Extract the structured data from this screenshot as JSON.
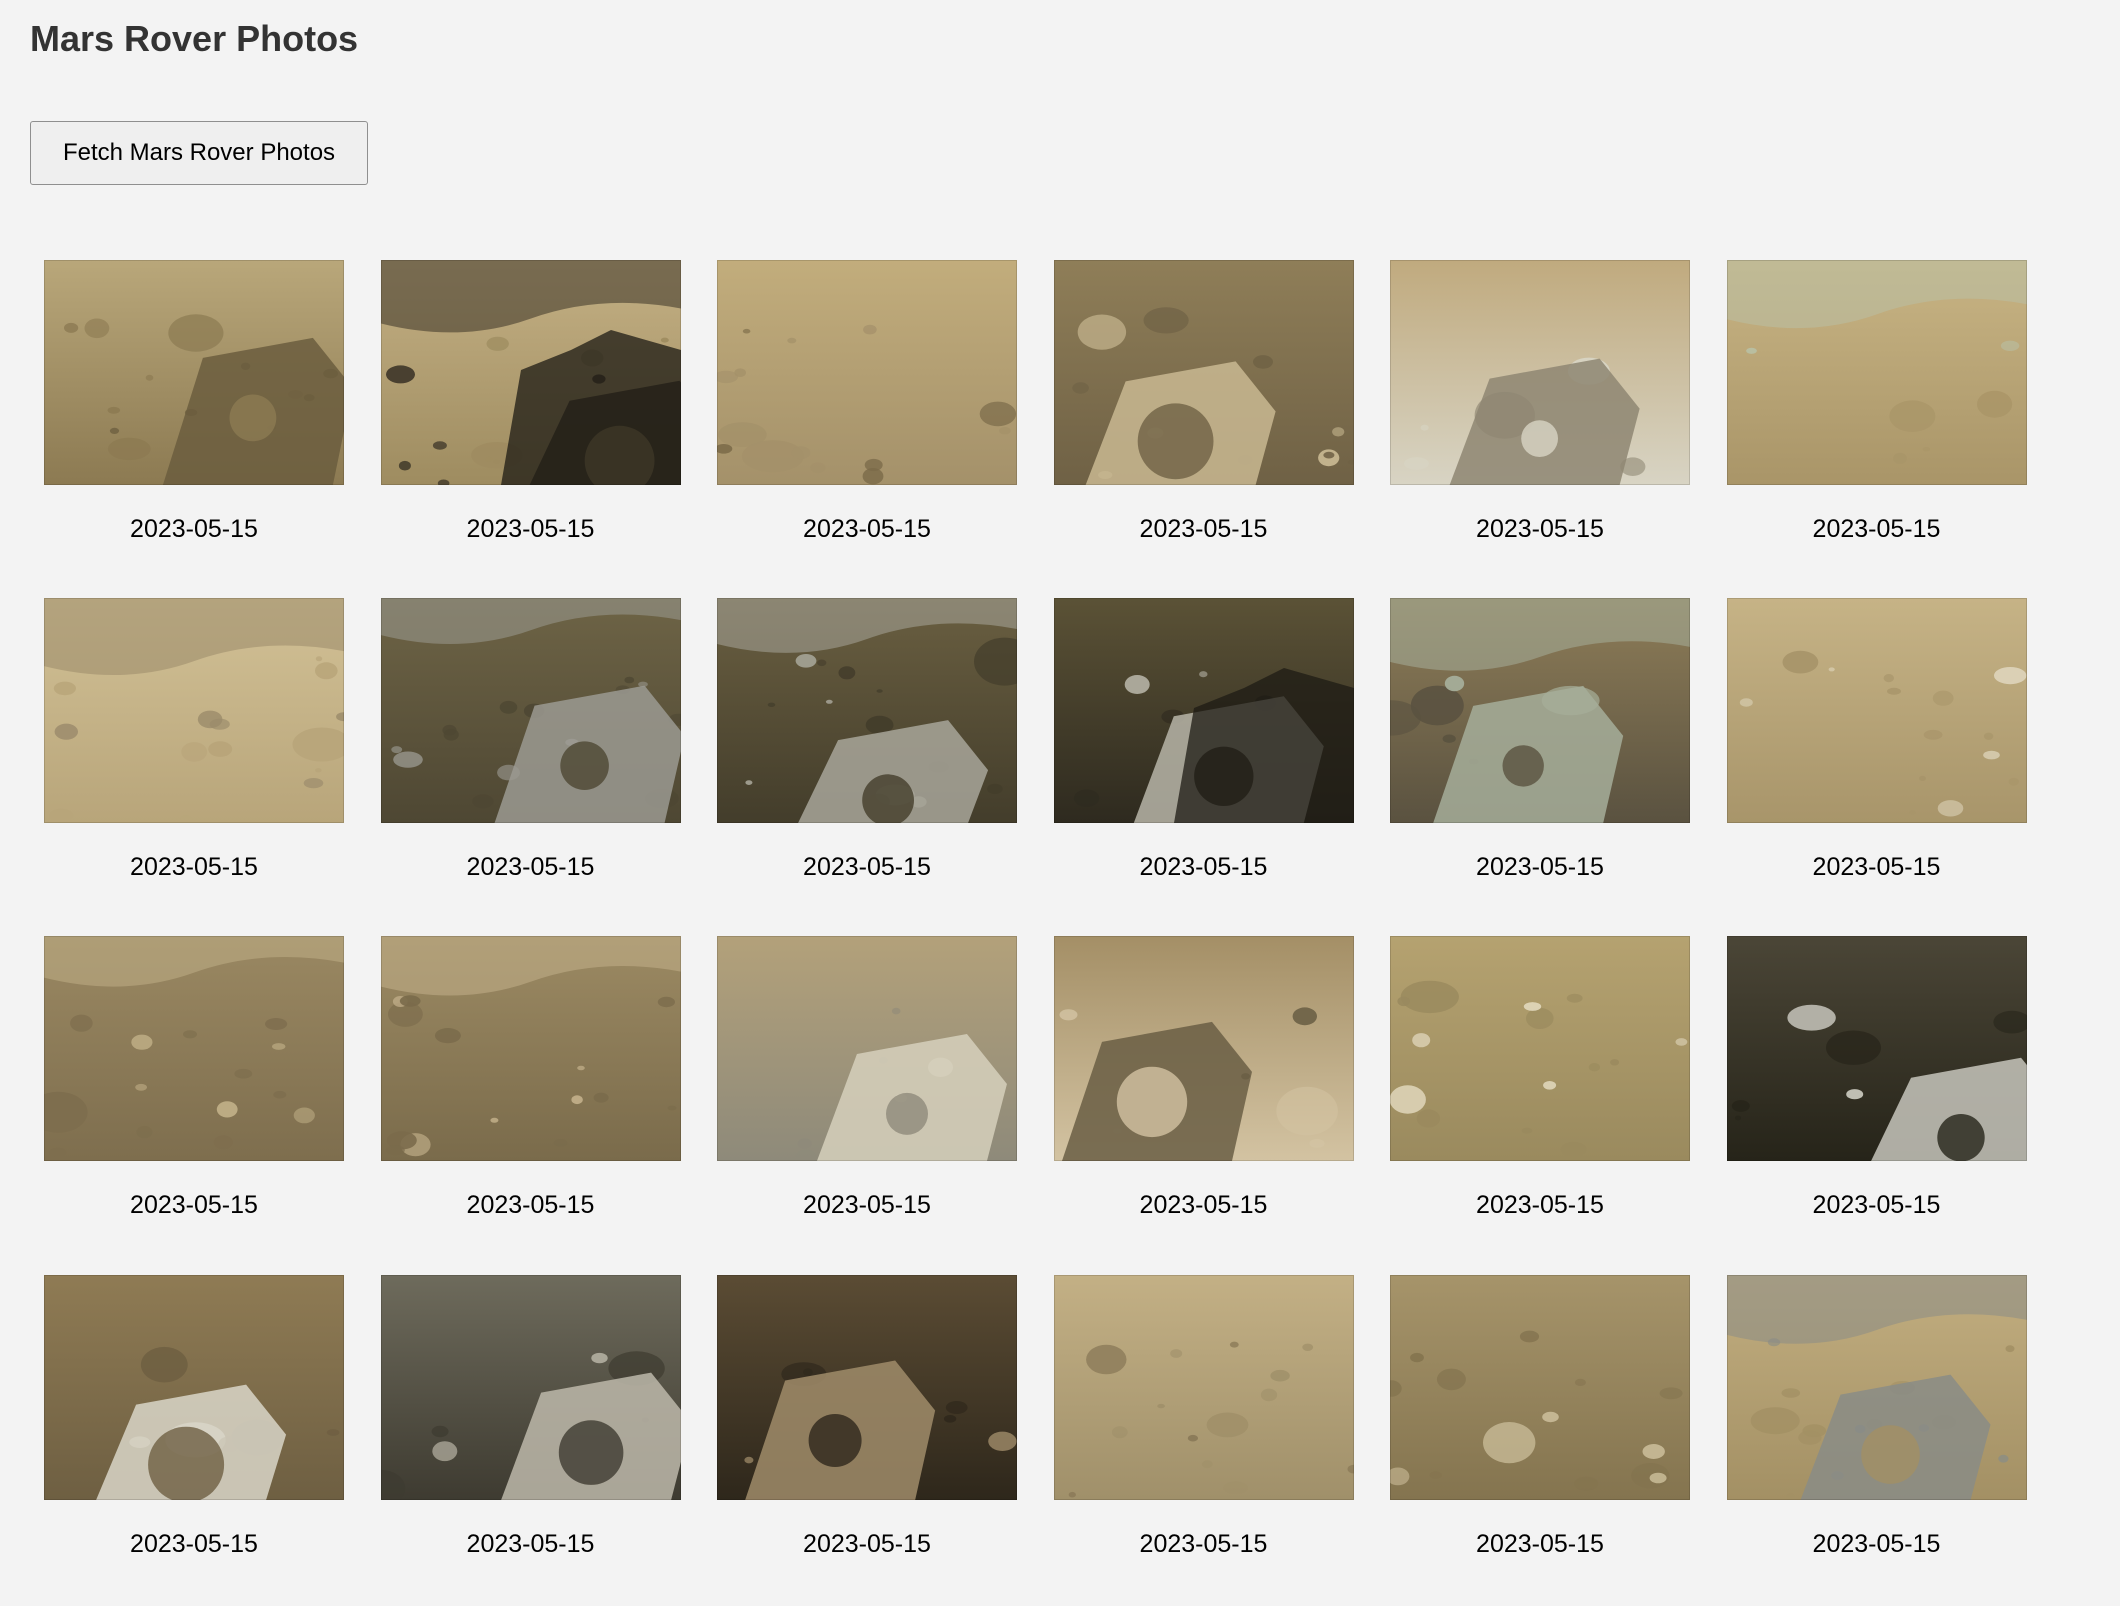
{
  "page": {
    "title": "Mars Rover Photos",
    "fetch_button_label": "Fetch Mars Rover Photos"
  },
  "photos": [
    {
      "date": "2023-05-15",
      "scene": "rocky-field-with-rover-wheel",
      "palette": [
        "#b9a77a",
        "#8c7a52",
        "#6b5d3e"
      ]
    },
    {
      "date": "2023-05-15",
      "scene": "sandy-plain-with-rover-shadow",
      "palette": [
        "#c4b084",
        "#9e8c60",
        "#3a3326"
      ]
    },
    {
      "date": "2023-05-15",
      "scene": "boulders-on-sand",
      "palette": [
        "#c2ad7c",
        "#a4916a",
        "#7a6a48"
      ]
    },
    {
      "date": "2023-05-15",
      "scene": "rock-near-rover-wheel",
      "palette": [
        "#8f7e58",
        "#6f6145",
        "#c9b892"
      ]
    },
    {
      "date": "2023-05-15",
      "scene": "rover-arm-and-instruments",
      "palette": [
        "#c0aa7e",
        "#d8d4c4",
        "#8e8672"
      ]
    },
    {
      "date": "2023-05-15",
      "scene": "horizon-with-sky",
      "palette": [
        "#c8b484",
        "#a99568",
        "#b9c0a4"
      ]
    },
    {
      "date": "2023-05-15",
      "scene": "hazy-plain-horizon",
      "palette": [
        "#d2c196",
        "#b8a57a",
        "#9a8a6a"
      ]
    },
    {
      "date": "2023-05-15",
      "scene": "dark-plain-with-mast",
      "palette": [
        "#6e6446",
        "#4e4733",
        "#9b9a92"
      ]
    },
    {
      "date": "2023-05-15",
      "scene": "dark-slope-with-rover-deck",
      "palette": [
        "#6a5f41",
        "#433d2b",
        "#a8a69a"
      ]
    },
    {
      "date": "2023-05-15",
      "scene": "rover-shadow-dark-terrain",
      "palette": [
        "#5b5236",
        "#2e2a1f",
        "#b7b5a8"
      ]
    },
    {
      "date": "2023-05-15",
      "scene": "rover-deck-and-hillside",
      "palette": [
        "#8e7d58",
        "#5a5240",
        "#a6ae9a"
      ]
    },
    {
      "date": "2023-05-15",
      "scene": "small-rocks-on-sand",
      "palette": [
        "#c6b386",
        "#a8956a",
        "#dcd2b8"
      ]
    },
    {
      "date": "2023-05-15",
      "scene": "bare-slope",
      "palette": [
        "#9a8862",
        "#7e6e4e",
        "#bfae86"
      ]
    },
    {
      "date": "2023-05-15",
      "scene": "scattered-rocks-slope",
      "palette": [
        "#9c8a63",
        "#7a6b4b",
        "#c2b08a"
      ]
    },
    {
      "date": "2023-05-15",
      "scene": "rover-arm-over-terrain",
      "palette": [
        "#b3a17a",
        "#8e8a7a",
        "#d6d0bc"
      ]
    },
    {
      "date": "2023-05-15",
      "scene": "rover-instrument-closeup",
      "palette": [
        "#a48f66",
        "#d3c3a2",
        "#6a5e44"
      ]
    },
    {
      "date": "2023-05-15",
      "scene": "pale-rocks-on-sand",
      "palette": [
        "#b5a270",
        "#9a8a5e",
        "#e0d6ba"
      ]
    },
    {
      "date": "2023-05-15",
      "scene": "rover-deck-machinery",
      "palette": [
        "#4b4637",
        "#262419",
        "#c7c6bc"
      ]
    },
    {
      "date": "2023-05-15",
      "scene": "rover-hardware-on-ground",
      "palette": [
        "#8f7b54",
        "#6e5f42",
        "#d9d6c8"
      ]
    },
    {
      "date": "2023-05-15",
      "scene": "rover-top-deck",
      "palette": [
        "#6e6b5c",
        "#3e3b31",
        "#bdb9aa"
      ]
    },
    {
      "date": "2023-05-15",
      "scene": "rover-sampling-bay",
      "palette": [
        "#5b4c34",
        "#2e271b",
        "#a08c6a"
      ]
    },
    {
      "date": "2023-05-15",
      "scene": "rock-field-bright",
      "palette": [
        "#c3b085",
        "#a0906a",
        "#8a7a58"
      ]
    },
    {
      "date": "2023-05-15",
      "scene": "lone-rock-on-sand",
      "palette": [
        "#a6946a",
        "#84744f",
        "#cbbd9a"
      ]
    },
    {
      "date": "2023-05-15",
      "scene": "hazy-plain-with-mast",
      "palette": [
        "#c2ae80",
        "#a39064",
        "#8a8c86"
      ]
    }
  ]
}
